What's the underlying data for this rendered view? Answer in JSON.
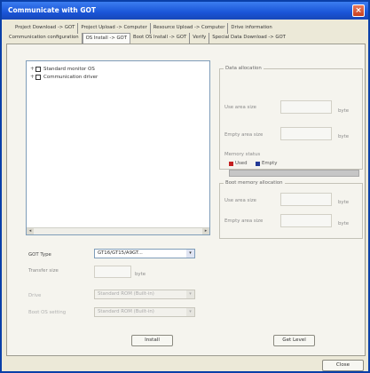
{
  "window": {
    "title": "Communicate with GOT"
  },
  "tabs_row1": [
    "Project Download -> GOT",
    "Project Upload -> Computer",
    "Resource Upload -> Computer",
    "Drive information"
  ],
  "tabs_row2": [
    "Communication configuration",
    "OS Install -> GOT",
    "Boot OS Install -> GOT",
    "Verify",
    "Special Data Download -> GOT"
  ],
  "tree": {
    "items": [
      "Standard monitor OS",
      "Communication driver"
    ]
  },
  "data_allocation": {
    "title": "Data allocation",
    "use_area_label": "Use area size",
    "empty_area_label": "Empty area size",
    "memory_status_label": "Memory status",
    "legend_used": "Used",
    "legend_empty": "Empty",
    "unit": "byte",
    "colors": {
      "used": "#c42020",
      "empty": "#233a96"
    }
  },
  "boot_memory_allocation": {
    "title": "Boot memory allocation",
    "use_area_label": "Use area size",
    "empty_area_label": "Empty area size",
    "unit": "byte"
  },
  "form": {
    "got_type_label": "GOT Type",
    "got_type_value": "GT16/GT15/A9GT...",
    "transfer_size_label": "Transfer size",
    "transfer_unit": "byte",
    "drive_label": "Drive",
    "drive_value": "Standard ROM (Built-in)",
    "boot_os_label": "Boot OS setting",
    "boot_os_value": "Standard ROM (Built-in)"
  },
  "buttons": {
    "install": "Install",
    "get_level": "Get Level",
    "close": "Close"
  }
}
